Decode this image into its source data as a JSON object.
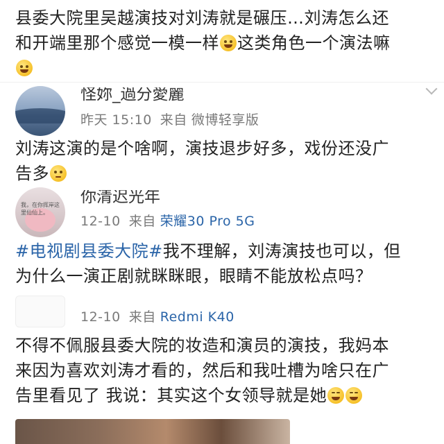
{
  "posts": [
    {
      "lines": [
        "县委大院里吴越演技对刘涛就是碾压…刘涛怎么还",
        "和开端里那个感觉一模一样",
        "这类角色一个演法嘛"
      ]
    },
    {
      "user": {
        "name": "怪妳_過分愛麗",
        "time": "昨天 15:10",
        "from": "来自",
        "device": "微博轻享版"
      },
      "lines": [
        "刘涛这演的是个啥啊，演技退步好多，戏份还没广",
        "告多"
      ]
    },
    {
      "user": {
        "name": "你清迟光年",
        "avatar_caption": "我，在你挥岸这里仙仙上。",
        "time": "12-10",
        "from": "来自",
        "device": "荣耀30 Pro 5G"
      },
      "hashtag": "#电视剧县委大院#",
      "lines": [
        "我不理解，刘涛演技也可以，但",
        "为什么一演正剧就眯眯眼，眼睛不能放松点吗？"
      ]
    },
    {
      "user": {
        "time": "12-10",
        "from": "来自",
        "device": "Redmi K40"
      },
      "lines": [
        "不得不佩服县委大院的妆造和演员的演技，我妈本",
        "来因为喜欢刘涛才看的，然后和我吐槽为啥只在广",
        "告里看见了 我说：其实这个女领导就是她"
      ]
    }
  ],
  "emojis": [
    "smile-emoji",
    "think-emoji",
    "laugh-emoji"
  ]
}
